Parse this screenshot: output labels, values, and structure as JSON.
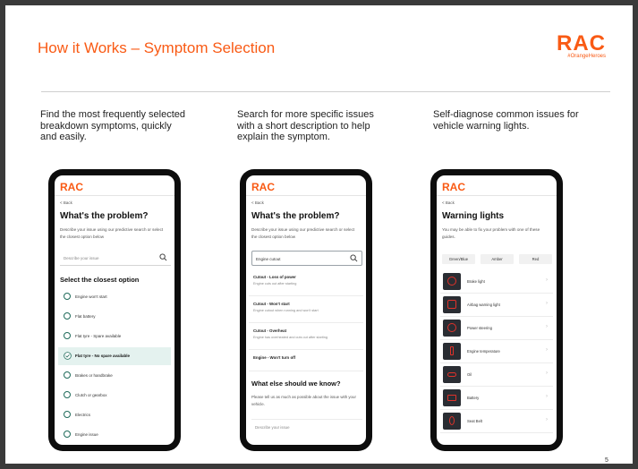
{
  "slide": {
    "title": "How it Works – Symptom Selection",
    "logo": "RAC",
    "logo_tag": "#OrangeHeroes",
    "page_number": "5",
    "brand_color": "#f95a14"
  },
  "captions": [
    "Find the most frequently selected breakdown symptoms, quickly and easily.",
    "Search for more specific issues with a short description to help explain the symptom.",
    "Self-diagnose common issues for vehicle warning lights."
  ],
  "phone1": {
    "logo": "RAC",
    "back": "< Back",
    "heading": "What's the problem?",
    "subtitle": "Describe your issue using our predictive search or select the closest option below",
    "search_placeholder": "Describe your issue",
    "options_heading": "Select the closest option",
    "options": [
      {
        "label": "Engine won't start"
      },
      {
        "label": "Flat battery"
      },
      {
        "label": "Flat tyre - Spare available"
      },
      {
        "label": "Flat tyre - No spare available"
      },
      {
        "label": "Brakes or handbrake"
      },
      {
        "label": "Clutch or gearbox"
      },
      {
        "label": "Electrics"
      },
      {
        "label": "Engine issue"
      }
    ],
    "selected_index": 3
  },
  "phone2": {
    "logo": "RAC",
    "back": "< Back",
    "heading": "What's the problem?",
    "subtitle": "Describe your issue using our predictive search or select the closest option below",
    "search_value": "Engine cutout",
    "suggestions": [
      {
        "title": "Cutout - Loss of power",
        "desc": "Engine cuts out after starting"
      },
      {
        "title": "Cutout - Won't start",
        "desc": "Engine cutout when running and won't start"
      },
      {
        "title": "Cutout - Overheat",
        "desc": "Engine has overheated and cuts out after starting"
      },
      {
        "title": "Engine - Won't turn off",
        "desc": ""
      }
    ],
    "more_heading": "What else should we know?",
    "more_subtitle": "Please tell us as much as possible about the issue with your vehicle.",
    "desc_placeholder": "Describe your issue"
  },
  "phone3": {
    "logo": "RAC",
    "back": "< Back",
    "heading": "Warning lights",
    "subtitle": "You may be able to fix your problem with one of these guides.",
    "tabs": [
      "Green/Blue",
      "Amber",
      "Red"
    ],
    "lights": [
      {
        "label": "Brake light"
      },
      {
        "label": "Airbag warning light"
      },
      {
        "label": "Power steering"
      },
      {
        "label": "Engine temperature"
      },
      {
        "label": "Oil"
      },
      {
        "label": "Battery"
      },
      {
        "label": "Seat Belt"
      }
    ]
  }
}
